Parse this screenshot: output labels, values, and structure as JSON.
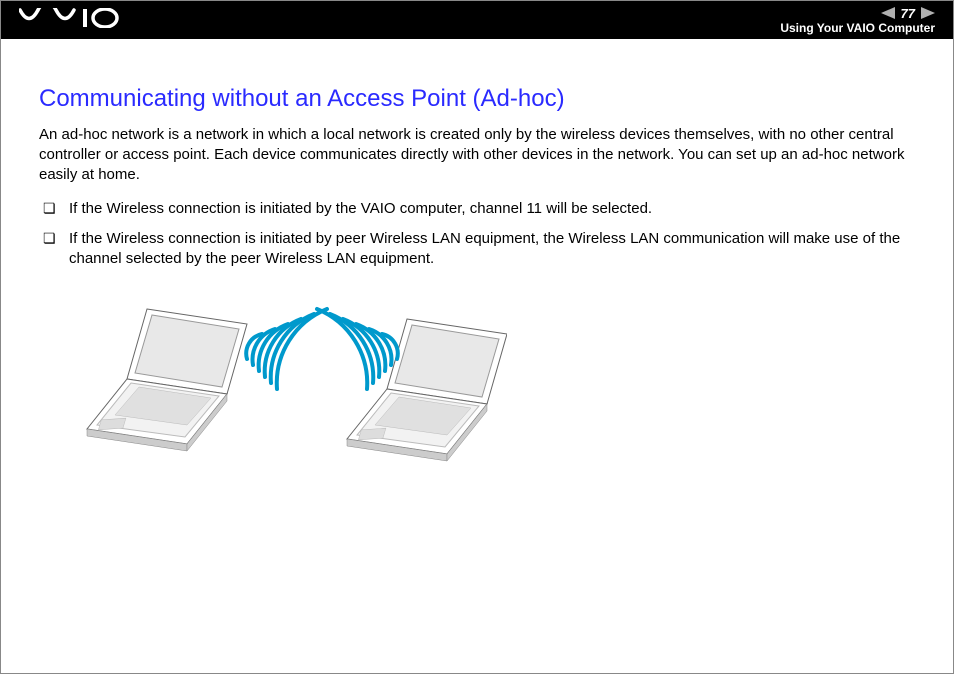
{
  "header": {
    "page_number": "77",
    "section": "Using Your VAIO Computer"
  },
  "content": {
    "title": "Communicating without an Access Point (Ad-hoc)",
    "paragraph": "An ad-hoc network is a network in which a local network is created only by the wireless devices themselves, with no other central controller or access point. Each device communicates directly with other devices in the network. You can set up an ad-hoc network easily at home.",
    "bullets": [
      "If the Wireless connection is initiated by the VAIO computer, channel 11 will be selected.",
      "If the Wireless connection is initiated by peer Wireless LAN equipment, the Wireless LAN communication will make use of the channel selected by the peer Wireless LAN equipment."
    ]
  }
}
